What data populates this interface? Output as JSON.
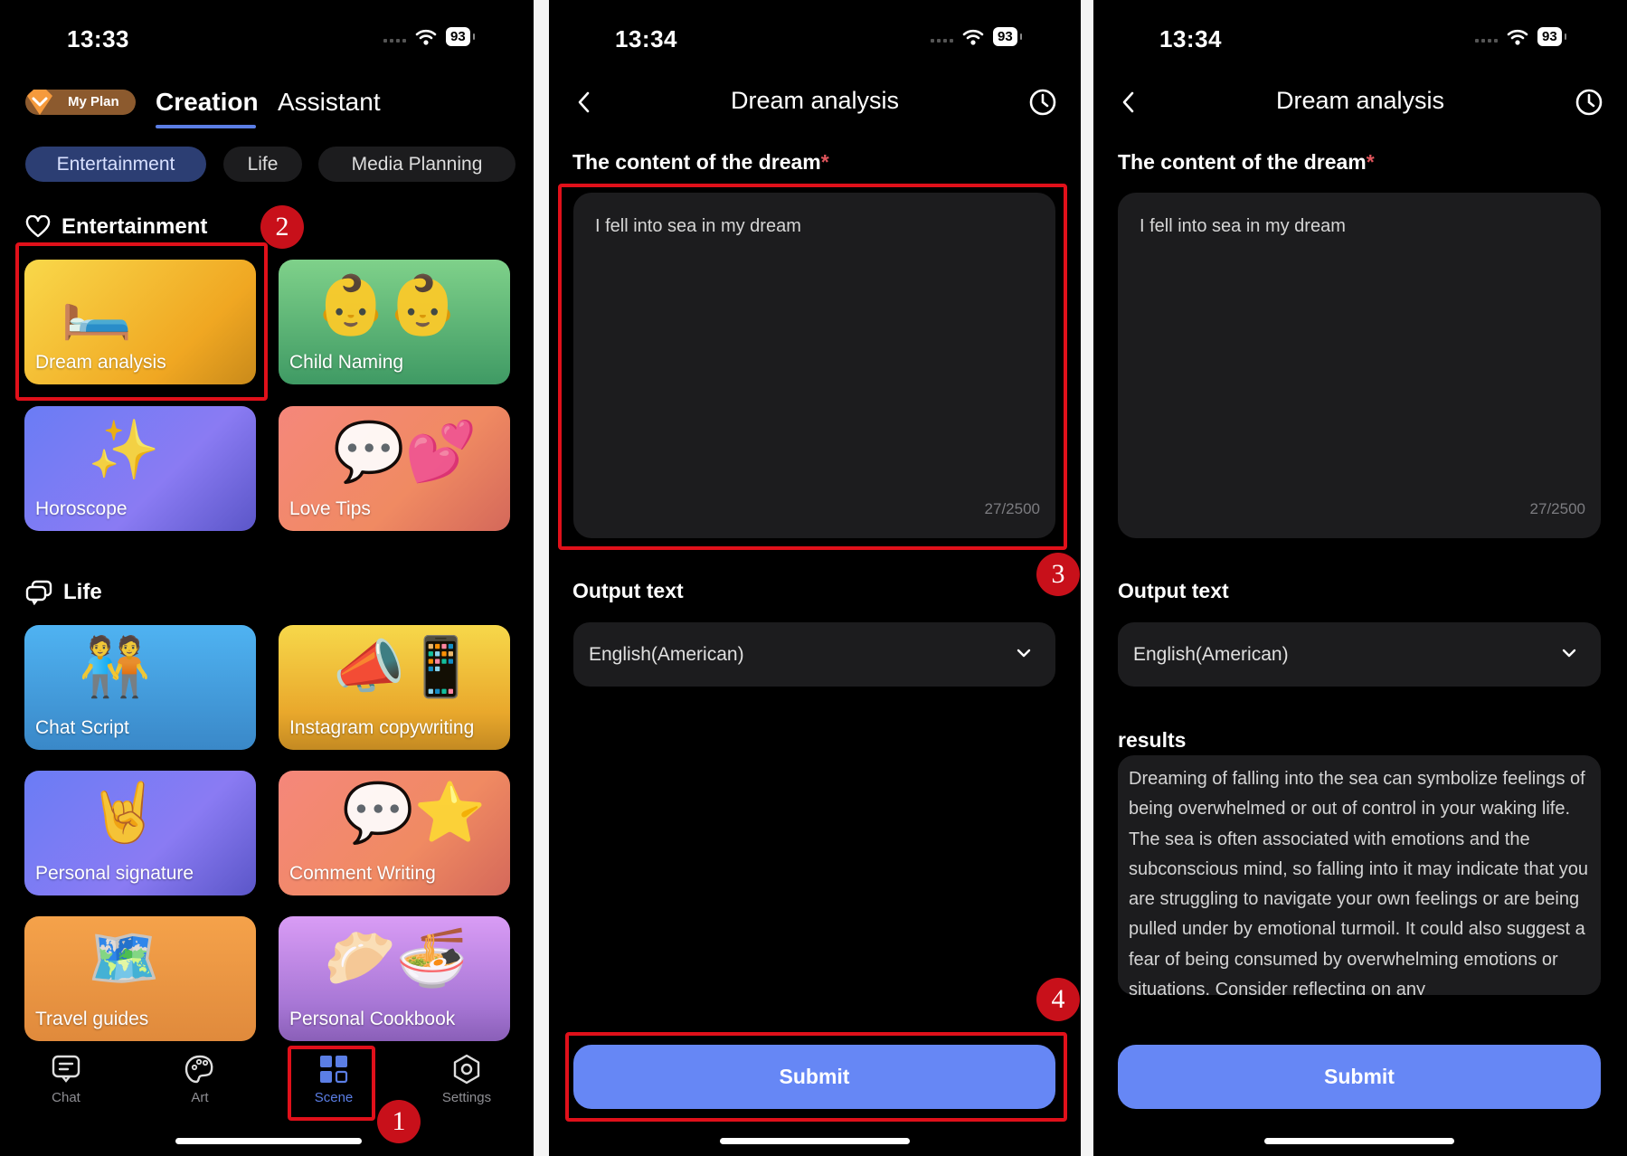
{
  "colors": {
    "accent": "#5b7ee5",
    "submit": "#6687f5",
    "annotation_red": "#e0101a",
    "field_bg": "#1c1c1e"
  },
  "screen1": {
    "status": {
      "time": "13:33",
      "battery": "93"
    },
    "my_plan_label": "My Plan",
    "tabs": [
      {
        "label": "Creation",
        "active": true
      },
      {
        "label": "Assistant",
        "active": false
      }
    ],
    "chips": [
      {
        "label": "Entertainment",
        "active": true
      },
      {
        "label": "Life",
        "active": false
      },
      {
        "label": "Media Planning",
        "active": false
      }
    ],
    "sections": [
      {
        "title": "Entertainment",
        "icon": "heart-icon",
        "cards": [
          {
            "label": "Dream analysis",
            "icon": "bed-icon"
          },
          {
            "label": "Child Naming",
            "icon": "babies-icon"
          },
          {
            "label": "Horoscope",
            "icon": "constellation-icon"
          },
          {
            "label": "Love Tips",
            "icon": "hearts-icon"
          }
        ]
      },
      {
        "title": "Life",
        "icon": "chat-bubbles-icon",
        "cards": [
          {
            "label": "Chat Script",
            "icon": "people-talking-icon"
          },
          {
            "label": "Instagram copywriting",
            "icon": "megaphone-icon"
          },
          {
            "label": "Personal signature",
            "icon": "cool-sign-icon"
          },
          {
            "label": "Comment Writing",
            "icon": "comments-icon"
          },
          {
            "label": "Travel guides",
            "icon": "map-icon"
          },
          {
            "label": "Personal Cookbook",
            "icon": "food-icon"
          }
        ]
      }
    ],
    "nav": [
      {
        "label": "Chat",
        "icon": "chat-icon",
        "active": false
      },
      {
        "label": "Art",
        "icon": "palette-icon",
        "active": false
      },
      {
        "label": "Scene",
        "icon": "grid-icon",
        "active": true
      },
      {
        "label": "Settings",
        "icon": "settings-hexagon-icon",
        "active": false
      }
    ]
  },
  "screen2": {
    "status": {
      "time": "13:34",
      "battery": "93"
    },
    "title": "Dream analysis",
    "content_label": "The content of the dream",
    "required_mark": "*",
    "content_value": "I fell into sea in my dream",
    "counter": "27/2500",
    "output_label": "Output text",
    "output_value": "English(American)",
    "submit_label": "Submit"
  },
  "screen3": {
    "status": {
      "time": "13:34",
      "battery": "93"
    },
    "title": "Dream analysis",
    "content_label": "The content of the dream",
    "required_mark": "*",
    "content_value": "I fell into sea in my dream",
    "counter": "27/2500",
    "output_label": "Output text",
    "output_value": "English(American)",
    "results_label": "results",
    "results_text": "Dreaming of falling into the sea can symbolize feelings of being overwhelmed or out of control in your waking life. The sea is often associated with emotions and the subconscious mind, so falling into it may indicate that you are struggling to navigate your own feelings or are being pulled under by emotional turmoil. It could also suggest a fear of being consumed by overwhelming emotions or situations. Consider reflecting on any",
    "submit_label": "Submit"
  },
  "annotations": [
    "1",
    "2",
    "3",
    "4"
  ]
}
